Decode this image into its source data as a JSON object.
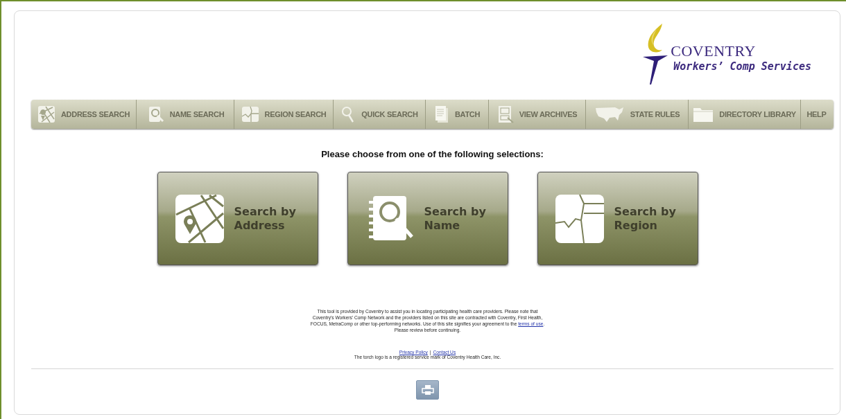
{
  "logo": {
    "name": "COVENTRY",
    "tagline": "Workers’ Comp Services"
  },
  "nav": [
    {
      "label": "ADDRESS SEARCH"
    },
    {
      "label": "NAME SEARCH"
    },
    {
      "label": "REGION SEARCH"
    },
    {
      "label": "QUICK SEARCH"
    },
    {
      "label": "BATCH"
    },
    {
      "label": "VIEW ARCHIVES"
    },
    {
      "label": "STATE RULES"
    },
    {
      "label": "DIRECTORY LIBRARY"
    },
    {
      "label": "HELP"
    }
  ],
  "heading": "Please choose from one of the following selections:",
  "cards": [
    {
      "label": "Search by Address"
    },
    {
      "label": "Search by Name"
    },
    {
      "label": "Search by Region"
    }
  ],
  "disclaimer": {
    "text_before": "This tool is provided by Coventry to assist you in locating participating health care providers. Please note that Coventry's Workers' Comp Network and the providers listed on this site are contracted with Coventry, First Health, FOCUS, MetraComp or other top-performing networks. Use of this site signifies your agreement to the",
    "link": "terms of use",
    "text_after": ". Please review before continuing."
  },
  "footer": {
    "links": [
      "Privacy Policy",
      "Contact Us"
    ],
    "separator": "|",
    "trademark": "The torch logo is a registered service mark of Coventry Health Care, Inc."
  }
}
